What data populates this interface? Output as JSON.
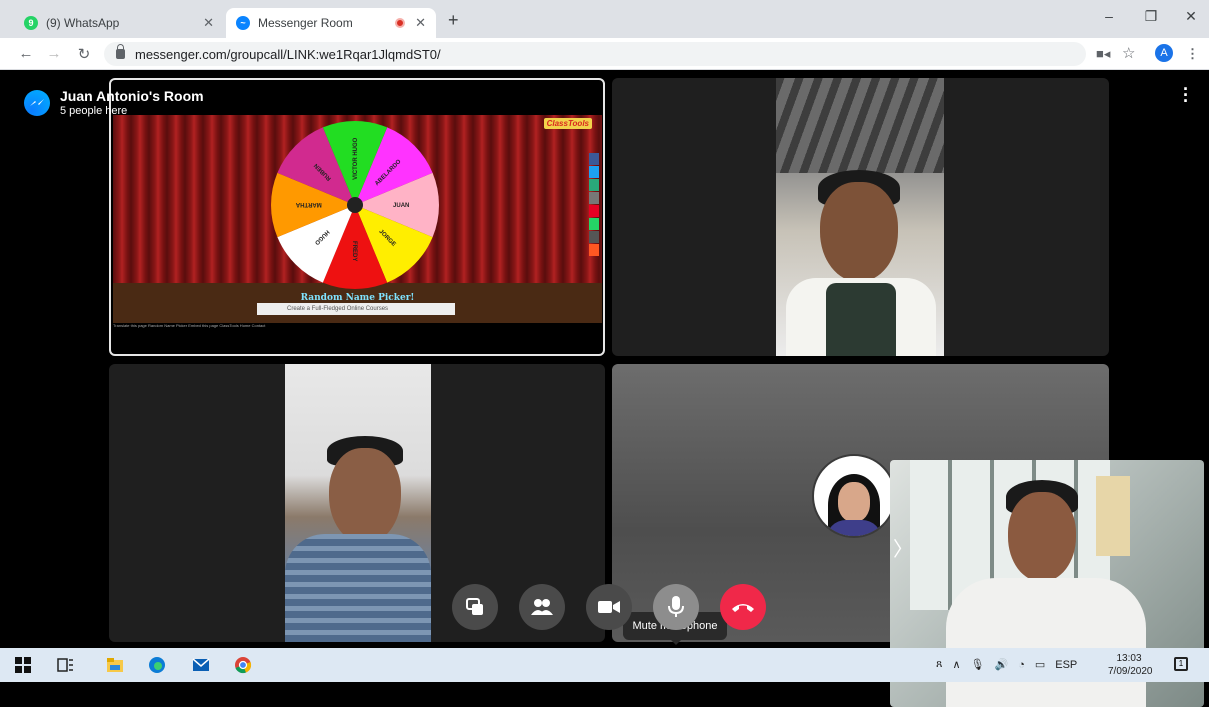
{
  "browser": {
    "tabs": [
      {
        "title": "(9) WhatsApp",
        "favicon": "whatsapp-icon",
        "active": false
      },
      {
        "title": "Messenger Room",
        "favicon": "messenger-icon",
        "active": true,
        "recording": true
      }
    ],
    "new_tab_label": "+",
    "url": "messenger.com/groupcall/LINK:we1Rqar1JlqmdST0/",
    "profile_initial": "A"
  },
  "room": {
    "title": "Juan Antonio's Room",
    "subtitle": "5 people here"
  },
  "shared_screen": {
    "picker_title": "Random Name Picker!",
    "site_logo": "ClassTools",
    "wheel_names": [
      "ABELARDO",
      "JUAN",
      "JORGE",
      "FREDY",
      "HUGO",
      "MARTHA",
      "RUBEN",
      "VICTOR HUGO"
    ],
    "wheel_colors": [
      "#ff33ff",
      "#ffb3c6",
      "#ffee00",
      "#ee1111",
      "#ffffff",
      "#ff9900",
      "#d12a8f",
      "#22dd22"
    ],
    "ad_text": "Create a Full-Fledged Online Courses",
    "footer_text": "Translate this page  Random Name Picker  Embed this page  ClassTools Home  Contact"
  },
  "controls": {
    "tooltip": "Mute microphone",
    "buttons": [
      "share-screen",
      "participants",
      "camera",
      "microphone",
      "end-call"
    ],
    "colors": {
      "end": "#f02849",
      "default": "#4a4a4a",
      "mic_hover": "#8d8d8d"
    }
  },
  "taskbar": {
    "language": "ESP",
    "time": "13:03",
    "date": "7/09/2020",
    "notifications": "1"
  }
}
